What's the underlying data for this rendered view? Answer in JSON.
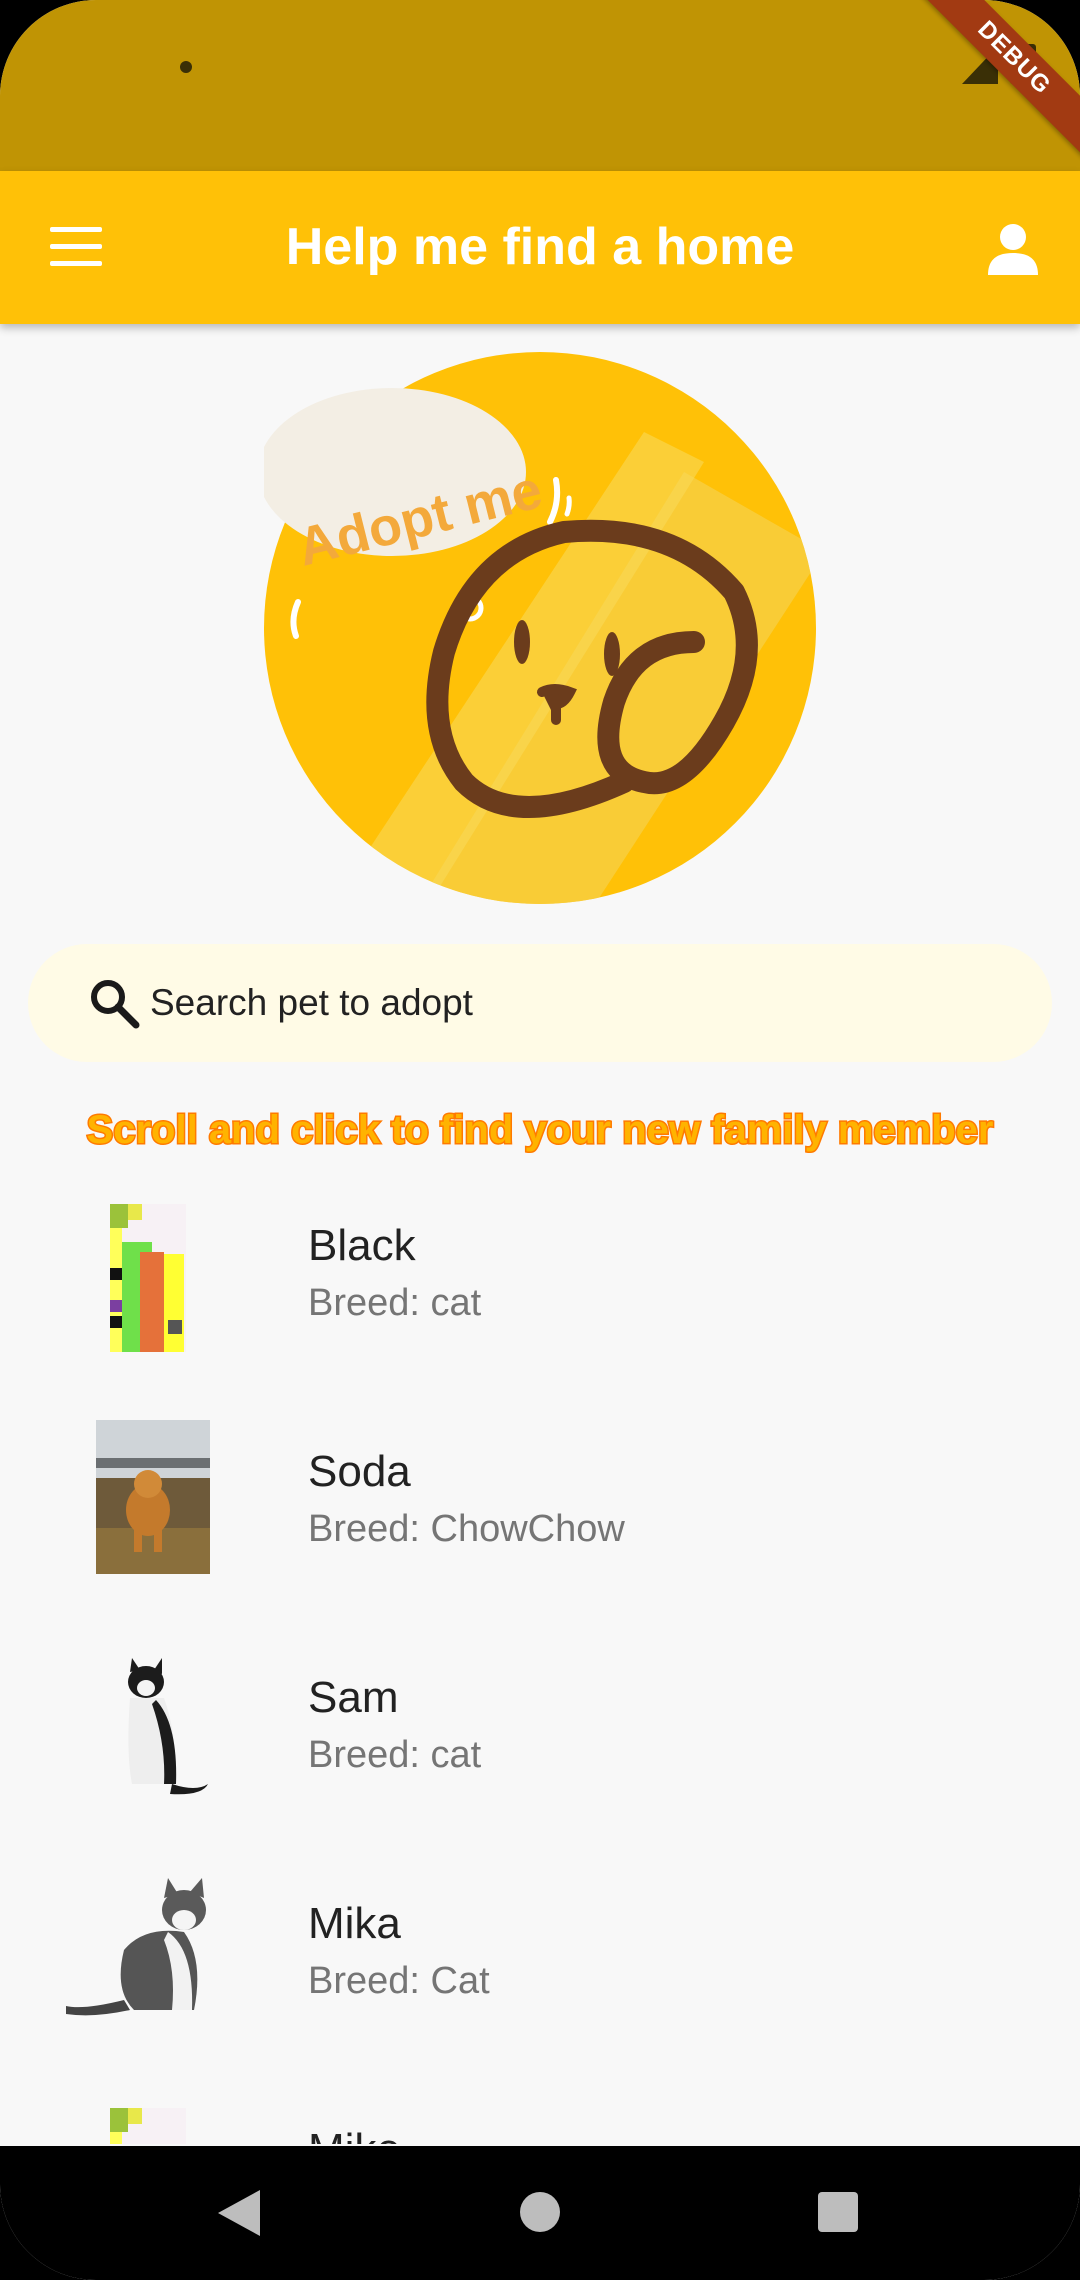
{
  "app_bar": {
    "title": "Help me find a home",
    "background": "#ffc107"
  },
  "debug_banner": "DEBUG",
  "hero": {
    "logo_text": "Adopt me"
  },
  "search": {
    "placeholder": "Search pet to adopt"
  },
  "subtitle": "Scroll and click to find your new family member",
  "pets": [
    {
      "name": "Black",
      "breed": "Breed: cat",
      "thumb": "pixel-art-icon"
    },
    {
      "name": "Soda",
      "breed": "Breed: ChowChow",
      "thumb": "dog-photo"
    },
    {
      "name": "Sam",
      "breed": "Breed: cat",
      "thumb": "cat-photo"
    },
    {
      "name": "Mika",
      "breed": "Breed: Cat",
      "thumb": "cat-photo"
    },
    {
      "name": "Mike",
      "breed": "",
      "thumb": "pixel-art-icon"
    }
  ],
  "colors": {
    "status_bar": "#c09404",
    "accent": "#ffc107",
    "subtitle": "#ffb300"
  }
}
